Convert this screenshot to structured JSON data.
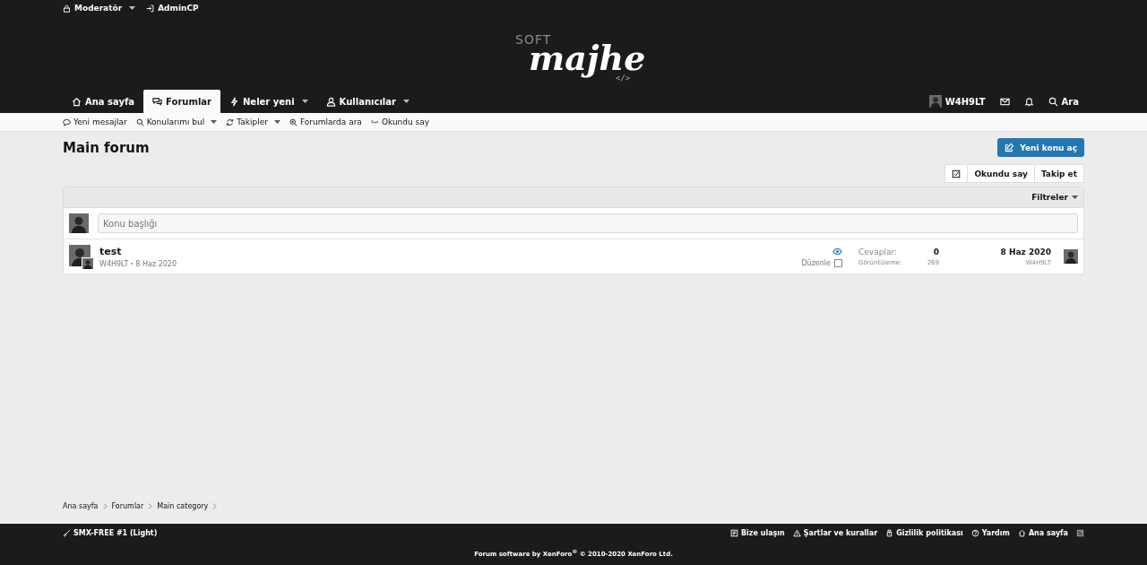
{
  "staff_bar": [
    {
      "label": "Moderatör",
      "dropdown": true
    },
    {
      "label": "AdminCP",
      "dropdown": false
    }
  ],
  "logo": {
    "small": "SOFT",
    "main": "majhe",
    "code": "</>"
  },
  "nav": {
    "tabs": [
      {
        "label": "Ana sayfa",
        "selected": false,
        "dropdown": false
      },
      {
        "label": "Forumlar",
        "selected": true,
        "dropdown": false
      },
      {
        "label": "Neler yeni",
        "selected": false,
        "dropdown": true
      },
      {
        "label": "Kullanıcılar",
        "selected": false,
        "dropdown": true
      }
    ],
    "user": "W4H9LT",
    "search": "Ara"
  },
  "subnav": [
    {
      "label": "Yeni mesajlar",
      "dropdown": false
    },
    {
      "label": "Konularımı bul",
      "dropdown": true
    },
    {
      "label": "Takipler",
      "dropdown": true
    },
    {
      "label": "Forumlarda ara",
      "dropdown": false
    },
    {
      "label": "Okundu say",
      "dropdown": false
    }
  ],
  "page_title": "Main forum",
  "new_thread_button": "Yeni konu aç",
  "actions": [
    "Okundu say",
    "Takip et"
  ],
  "filter": "Filtreler",
  "quick_thread": {
    "placeholder": "Konu başlığı"
  },
  "threads": [
    {
      "title": "test",
      "author": "W4H9LT",
      "date": "8 Haz 2020",
      "select_label": "Düzenle",
      "selected": false,
      "replies_label": "Cevaplar:",
      "replies": "0",
      "views_label": "Görüntüleme:",
      "views": "269",
      "last_date": "8 Haz 2020",
      "last_user": "W4H9LT"
    }
  ],
  "breadcrumbs": [
    "Ana sayfa",
    "Forumlar",
    "Main category"
  ],
  "footer": {
    "style": "SMX-FREE #1 (Light)",
    "links": [
      "Bize ulaşın",
      "Şartlar ve kurallar",
      "Gizlilik politikası",
      "Yardım",
      "Ana sayfa"
    ],
    "copyright": "Forum software by XenForo$^{®}$ © 2010-2020 XenForo Ltd."
  }
}
